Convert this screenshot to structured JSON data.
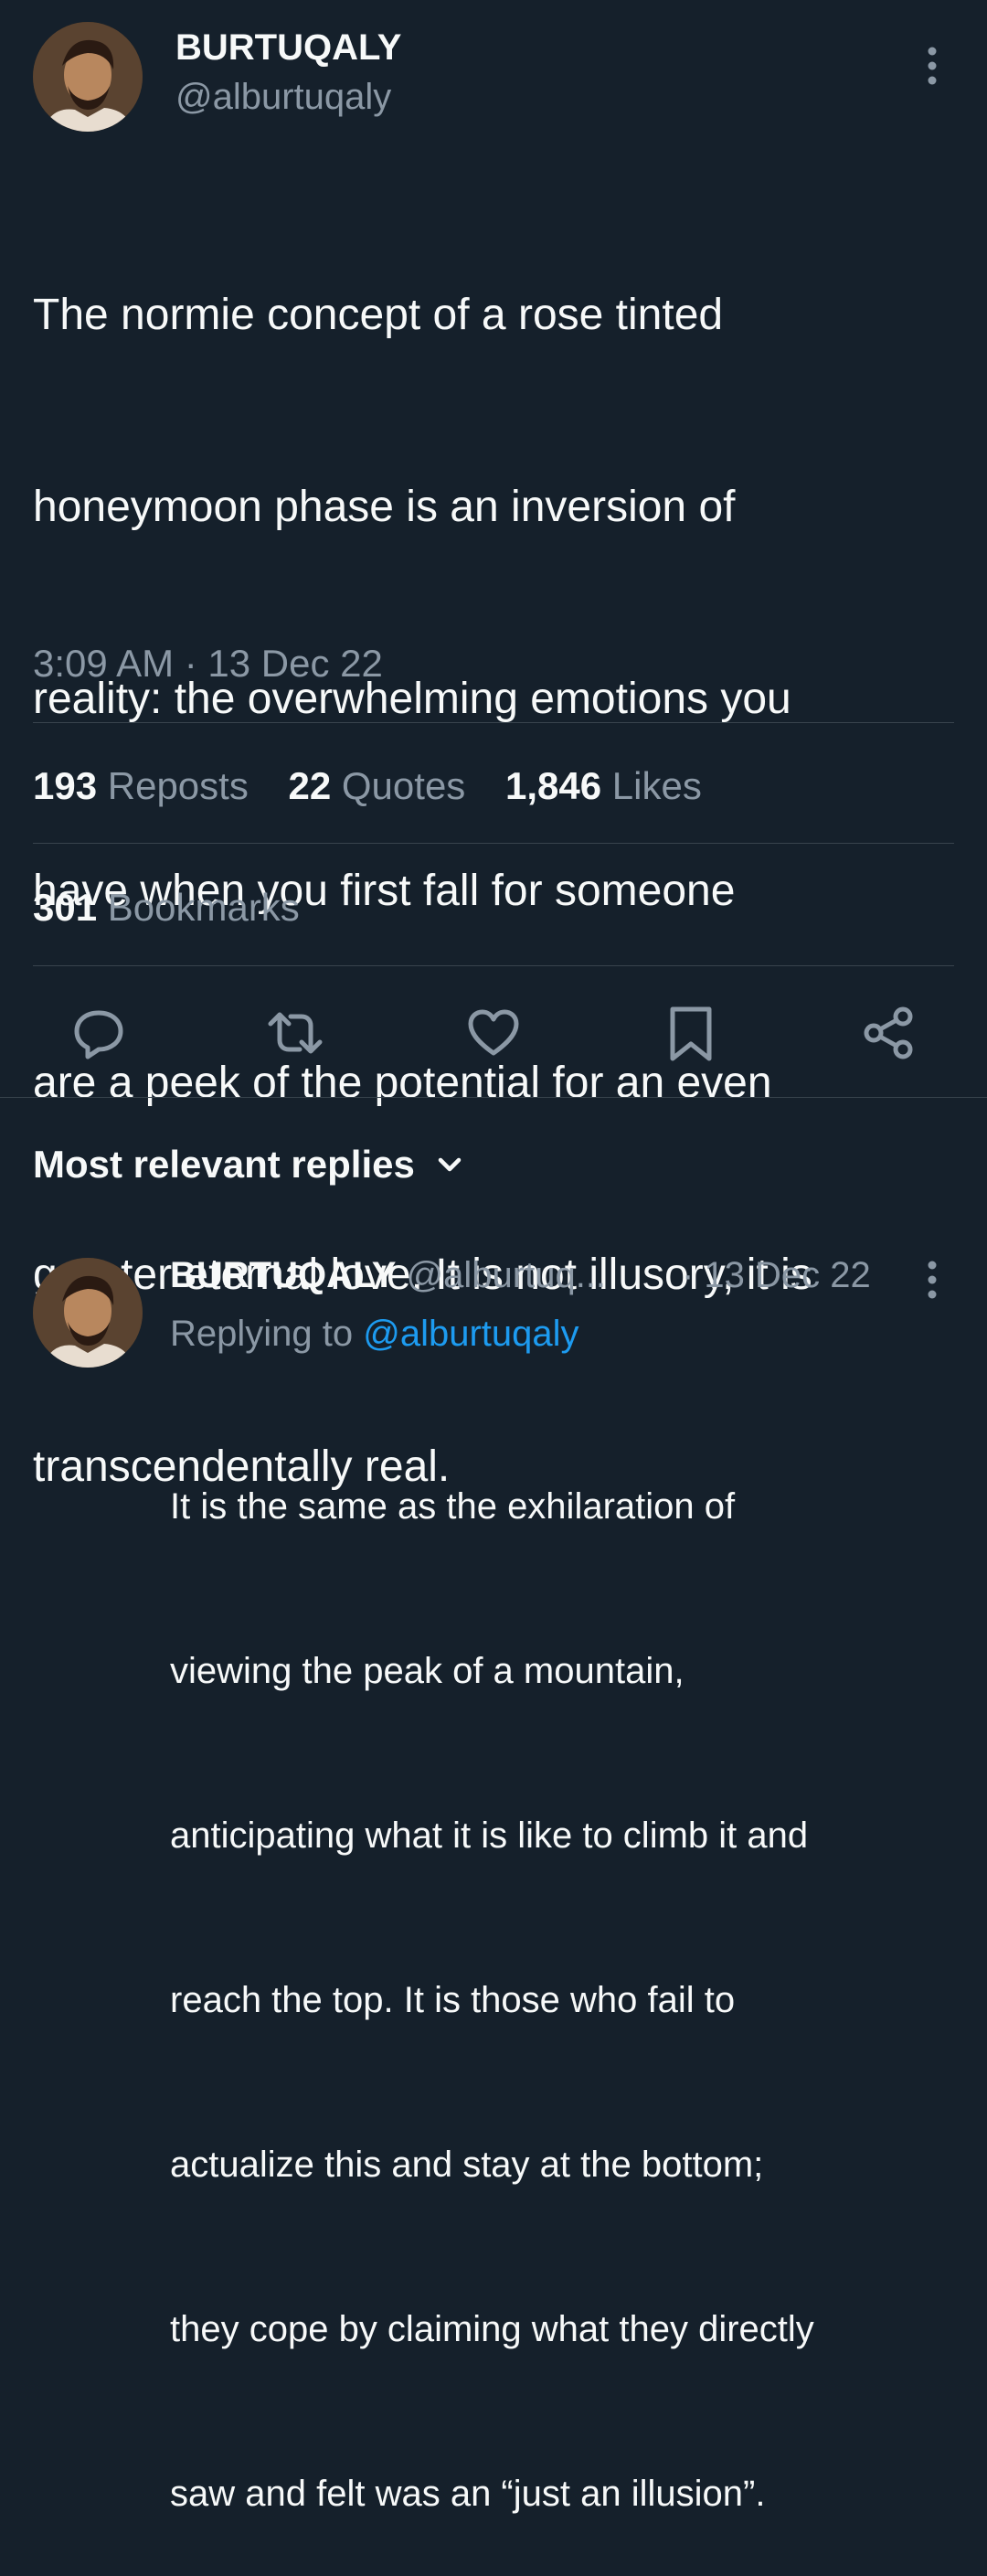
{
  "tweet": {
    "author_name": "BURTUQALY",
    "author_handle": "@alburtuqaly",
    "text_lines": [
      "The normie concept of a rose tinted",
      "honeymoon phase is an inversion of",
      "reality: the overwhelming emotions you",
      "have when you first fall for someone",
      "are a peek of the potential for an even",
      "greater eternal love. It is not illusory, it is",
      "transcendentally real."
    ],
    "timestamp": "3:09 AM · 13 Dec 22"
  },
  "stats": {
    "reposts_count": "193",
    "reposts_label": "Reposts",
    "quotes_count": "22",
    "quotes_label": "Quotes",
    "likes_count": "1,846",
    "likes_label": "Likes",
    "bookmarks_count": "301",
    "bookmarks_label": "Bookmarks"
  },
  "actions": [
    "reply-icon",
    "repost-icon",
    "like-icon",
    "bookmark-icon",
    "share-icon"
  ],
  "replies_header": {
    "label": "Most relevant replies"
  },
  "reply": {
    "author_name": "BURTUQALY",
    "author_handle": "@alburtuq...",
    "date": "· 13 Dec 22",
    "replying_to_label": "Replying to",
    "replying_to_handle": "@alburtuqaly",
    "text_lines": [
      "It is the same as the exhilaration of",
      "viewing the peak of a mountain,",
      "anticipating what it is like to climb it and",
      "reach the top. It is those who fail to",
      "actualize this and stay at the bottom;",
      "they cope by claiming what they directly",
      "saw and felt was an “just an illusion”."
    ]
  },
  "colors": {
    "background": "#15202b",
    "text": "#f7f9f9",
    "muted": "#8b98a5",
    "link": "#1d9bf0",
    "divider": "#38444d"
  }
}
